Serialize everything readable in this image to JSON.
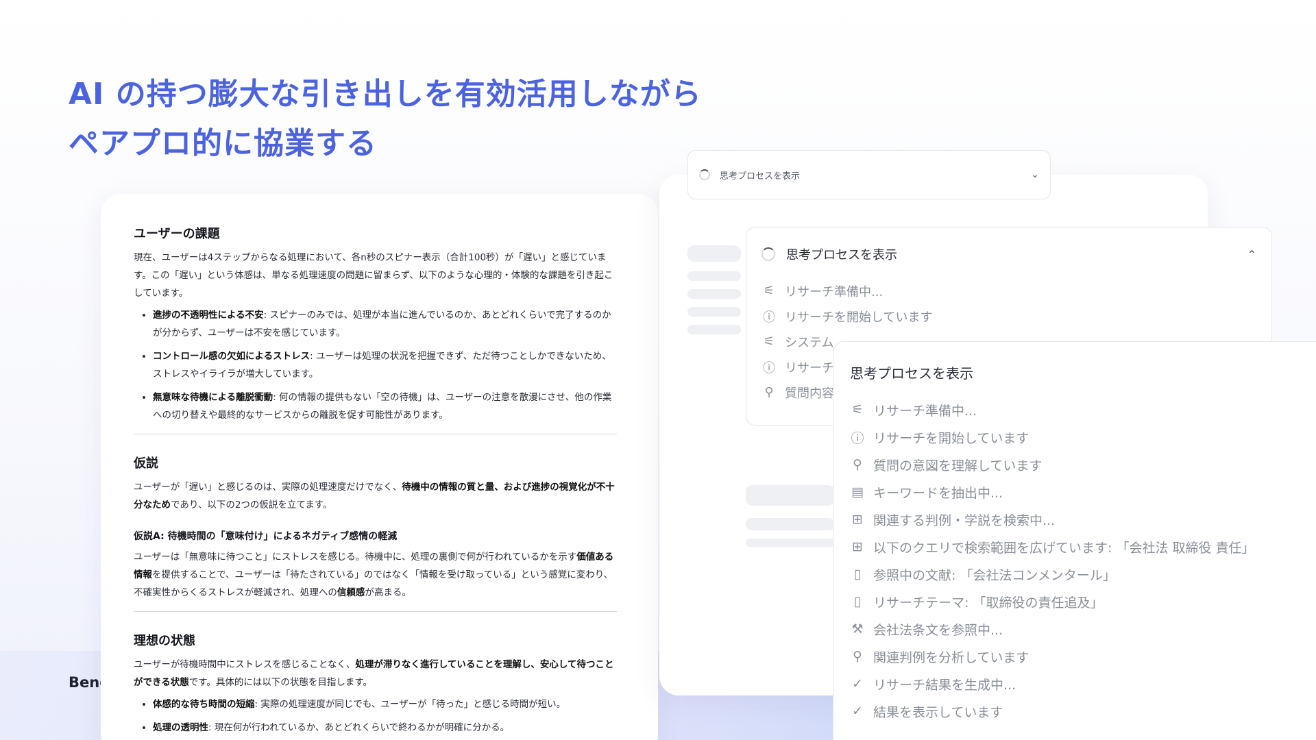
{
  "headline": {
    "line1": "AI の持つ膨大な引き出しを有効活用しながら",
    "line2": "ペアプロ的に協業する"
  },
  "brand": "Beng",
  "document": {
    "section1": {
      "title": "ユーザーの課題",
      "body": "現在、ユーザーは4ステップからなる処理において、各n秒のスピナー表示（合計100秒）が「遅い」と感じています。この「遅い」という体感は、単なる処理速度の問題に留まらず、以下のような心理的・体験的な課題を引き起こしています。",
      "bullets": [
        {
          "bold": "進捗の不透明性による不安",
          "text": ": スピナーのみでは、処理が本当に進んでいるのか、あとどれくらいで完了するのかが分からず、ユーザーは不安を感じています。"
        },
        {
          "bold": "コントロール感の欠如によるストレス",
          "text": ": ユーザーは処理の状況を把握できず、ただ待つことしかできないため、ストレスやイライラが増大しています。"
        },
        {
          "bold": "無意味な待機による離脱衝動",
          "text": ": 何の情報の提供もない「空の待機」は、ユーザーの注意を散漫にさせ、他の作業への切り替えや最終的なサービスからの離脱を促す可能性があります。"
        }
      ]
    },
    "section2": {
      "title": "仮説",
      "body_pre": "ユーザーが「遅い」と感じるのは、実際の処理速度だけでなく、",
      "body_bold": "待機中の情報の質と量、および進捗の視覚化が不十分なため",
      "body_post": "であり、以下の2つの仮説を立てます。",
      "sub_title": "仮説A: 待機時間の「意味付け」によるネガティブ感情の軽減",
      "sub_pre": "ユーザーは「無意味に待つこと」にストレスを感じる。待機中に、処理の裏側で何が行われているかを示す",
      "sub_bold1": "価値ある情報",
      "sub_mid": "を提供することで、ユーザーは「待たされている」のではなく「情報を受け取っている」という感覚に変わり、不確実性からくるストレスが軽減され、処理への",
      "sub_bold2": "信頼感",
      "sub_post": "が高まる。"
    },
    "section3": {
      "title": "理想の状態",
      "body_pre": "ユーザーが待機時間中にストレスを感じることなく、",
      "body_bold": "処理が滞りなく進行していることを理解し、安心して待つことができる状態",
      "body_post": "です。具体的には以下の状態を目指します。",
      "bullets": [
        {
          "bold": "体感的な待ち時間の短縮",
          "text": ": 実際の処理速度が同じでも、ユーザーが「待った」と感じる時間が短い。"
        },
        {
          "bold": "処理の透明性",
          "text": ": 現在何が行われているか、あとどれくらいで終わるかが明確に分かる。"
        }
      ]
    }
  },
  "panel1": {
    "label": "思考プロセスを表示"
  },
  "panel2": {
    "label": "思考プロセスを表示",
    "items": [
      {
        "icon": "sliders-icon",
        "glyph": "⚟",
        "text": "リサーチ準備中..."
      },
      {
        "icon": "info-icon",
        "glyph": "ⓘ",
        "text": "リサーチを開始しています"
      },
      {
        "icon": "sliders-icon",
        "glyph": "⚟",
        "text": "システム"
      },
      {
        "icon": "info-icon",
        "glyph": "ⓘ",
        "text": "リサーチ"
      },
      {
        "icon": "search-icon",
        "glyph": "⚲",
        "text": "質問内容"
      }
    ]
  },
  "panel3": {
    "title": "思考プロセスを表示",
    "items": [
      {
        "icon": "sliders-icon",
        "glyph": "⚟",
        "text": "リサーチ準備中..."
      },
      {
        "icon": "info-icon",
        "glyph": "ⓘ",
        "text": "リサーチを開始しています"
      },
      {
        "icon": "search-icon",
        "glyph": "⚲",
        "text": "質問の意図を理解しています"
      },
      {
        "icon": "document-icon",
        "glyph": "▤",
        "text": "キーワードを抽出中..."
      },
      {
        "icon": "open-book-icon",
        "glyph": "⊞",
        "text": "関連する判例・学説を検索中..."
      },
      {
        "icon": "open-book-icon",
        "glyph": "⊞",
        "text": "以下のクエリで検索範囲を広げています: 「会社法 取締役 責任」"
      },
      {
        "icon": "book-icon",
        "glyph": "▯",
        "text": "参照中の文献: 「会社法コンメンタール」"
      },
      {
        "icon": "book-icon",
        "glyph": "▯",
        "text": "リサーチテーマ: 「取締役の責任追及」"
      },
      {
        "icon": "gavel-icon",
        "glyph": "⚒",
        "text": "会社法条文を参照中..."
      },
      {
        "icon": "search-icon",
        "glyph": "⚲",
        "text": "関連判例を分析しています"
      },
      {
        "icon": "check-circle-icon",
        "glyph": "✓",
        "text": "リサーチ結果を生成中..."
      },
      {
        "icon": "check-circle-icon",
        "glyph": "✓",
        "text": "結果を表示しています"
      }
    ]
  }
}
